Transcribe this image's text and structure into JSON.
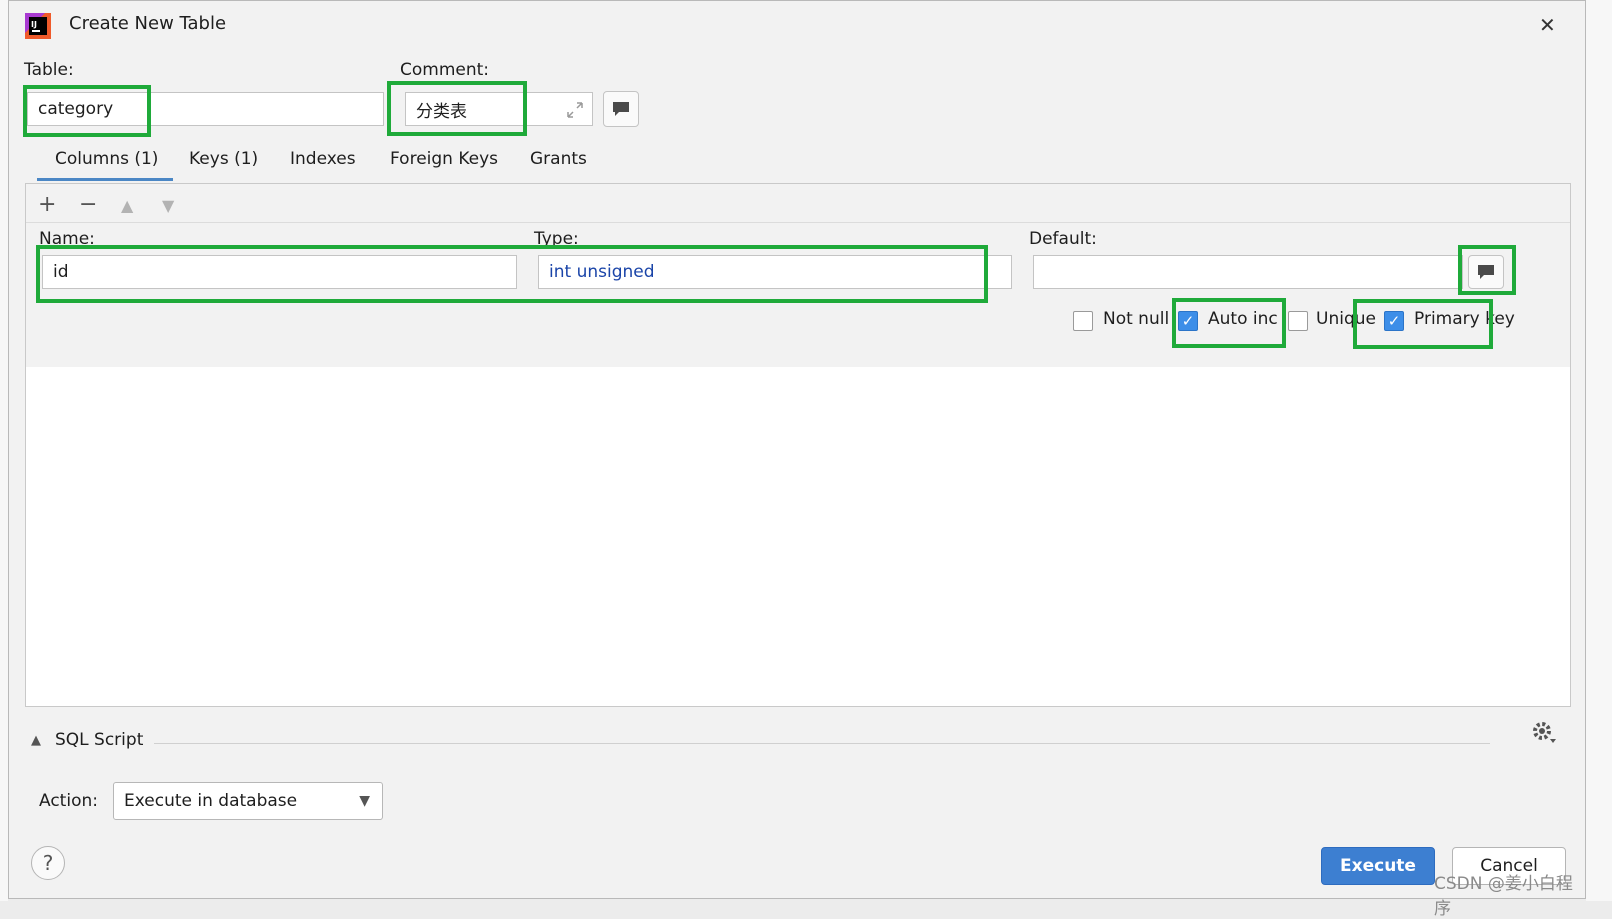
{
  "window": {
    "title": "Create New Table",
    "close_glyph": "✕",
    "logo_icon": "jetbrains-logo"
  },
  "table": {
    "label": "Table:",
    "value": "category"
  },
  "comment": {
    "label": "Comment:",
    "value": "分类表",
    "expand_icon": "expand-icon",
    "edit_icon": "comment-icon"
  },
  "tabs": [
    {
      "label": "Columns (1)",
      "active": true
    },
    {
      "label": "Keys (1)",
      "active": false
    },
    {
      "label": "Indexes",
      "active": false
    },
    {
      "label": "Foreign Keys",
      "active": false
    },
    {
      "label": "Grants",
      "active": false
    }
  ],
  "toolbar": {
    "add": "+",
    "remove": "−",
    "up": "▲",
    "down": "▼"
  },
  "column": {
    "name_label": "Name:",
    "name_value": "id",
    "type_label": "Type:",
    "type_value": "int unsigned",
    "default_label": "Default:",
    "default_value": ""
  },
  "options": [
    {
      "label": "Not null",
      "checked": false
    },
    {
      "label": "Auto inc",
      "checked": true
    },
    {
      "label": "Unique",
      "checked": false
    },
    {
      "label": "Primary key",
      "checked": true
    }
  ],
  "sql": {
    "label": "SQL Script",
    "toggle_glyph": "▲"
  },
  "action": {
    "label": "Action:",
    "value": "Execute in database"
  },
  "buttons": {
    "help": "?",
    "execute": "Execute",
    "cancel": "Cancel"
  },
  "watermark": "CSDN @姜小白程序",
  "colors": {
    "highlight": "#1faa3a",
    "accent": "#3d7fd1",
    "type_text": "#1a44a8"
  }
}
